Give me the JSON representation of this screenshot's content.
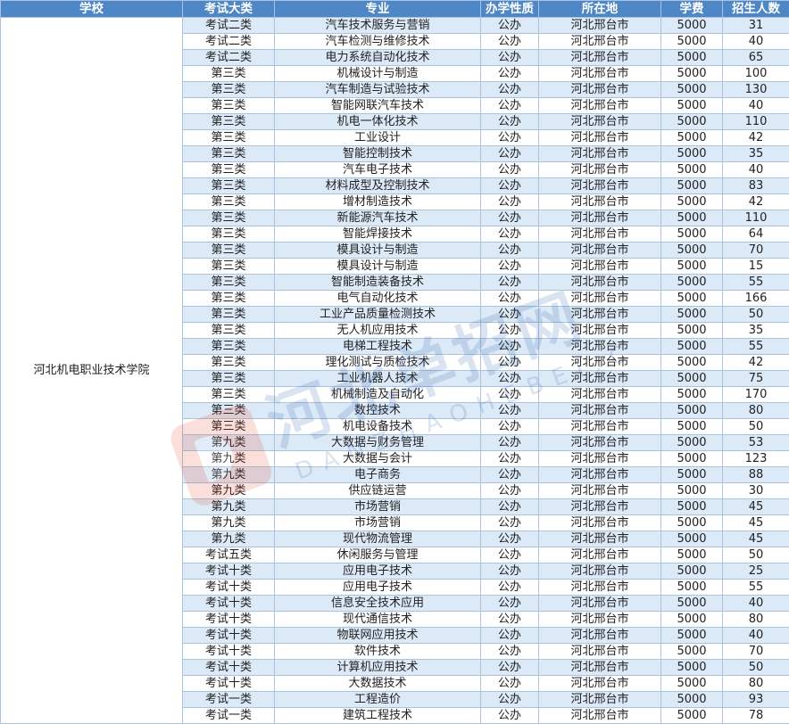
{
  "headers": [
    "学校",
    "考试大类",
    "专业",
    "办学性质",
    "所在地",
    "学费",
    "招生人数"
  ],
  "school": "河北机电职业技术学院",
  "rows": [
    [
      "考试二类",
      "汽车技术服务与营销",
      "公办",
      "河北邢台市",
      "5000",
      "31"
    ],
    [
      "考试二类",
      "汽车检测与维修技术",
      "公办",
      "河北邢台市",
      "5000",
      "40"
    ],
    [
      "考试二类",
      "电力系统自动化技术",
      "公办",
      "河北邢台市",
      "5000",
      "65"
    ],
    [
      "第三类",
      "机械设计与制造",
      "公办",
      "河北邢台市",
      "5000",
      "100"
    ],
    [
      "第三类",
      "汽车制造与试验技术",
      "公办",
      "河北邢台市",
      "5000",
      "130"
    ],
    [
      "第三类",
      "智能网联汽车技术",
      "公办",
      "河北邢台市",
      "5000",
      "40"
    ],
    [
      "第三类",
      "机电一体化技术",
      "公办",
      "河北邢台市",
      "5000",
      "110"
    ],
    [
      "第三类",
      "工业设计",
      "公办",
      "河北邢台市",
      "5000",
      "42"
    ],
    [
      "第三类",
      "智能控制技术",
      "公办",
      "河北邢台市",
      "5000",
      "35"
    ],
    [
      "第三类",
      "汽车电子技术",
      "公办",
      "河北邢台市",
      "5000",
      "40"
    ],
    [
      "第三类",
      "材料成型及控制技术",
      "公办",
      "河北邢台市",
      "5000",
      "83"
    ],
    [
      "第三类",
      "增材制造技术",
      "公办",
      "河北邢台市",
      "5000",
      "42"
    ],
    [
      "第三类",
      "新能源汽车技术",
      "公办",
      "河北邢台市",
      "5000",
      "110"
    ],
    [
      "第三类",
      "智能焊接技术",
      "公办",
      "河北邢台市",
      "5000",
      "64"
    ],
    [
      "第三类",
      "模具设计与制造",
      "公办",
      "河北邢台市",
      "5000",
      "70"
    ],
    [
      "第三类",
      "模具设计与制造",
      "公办",
      "河北邢台市",
      "5000",
      "15"
    ],
    [
      "第三类",
      "智能制造装备技术",
      "公办",
      "河北邢台市",
      "5000",
      "55"
    ],
    [
      "第三类",
      "电气自动化技术",
      "公办",
      "河北邢台市",
      "5000",
      "166"
    ],
    [
      "第三类",
      "工业产品质量检测技术",
      "公办",
      "河北邢台市",
      "5000",
      "50"
    ],
    [
      "第三类",
      "无人机应用技术",
      "公办",
      "河北邢台市",
      "5000",
      "35"
    ],
    [
      "第三类",
      "电梯工程技术",
      "公办",
      "河北邢台市",
      "5000",
      "55"
    ],
    [
      "第三类",
      "理化测试与质检技术",
      "公办",
      "河北邢台市",
      "5000",
      "42"
    ],
    [
      "第三类",
      "工业机器人技术",
      "公办",
      "河北邢台市",
      "5000",
      "75"
    ],
    [
      "第三类",
      "机械制造及自动化",
      "公办",
      "河北邢台市",
      "5000",
      "170"
    ],
    [
      "第三类",
      "数控技术",
      "公办",
      "河北邢台市",
      "5000",
      "80"
    ],
    [
      "第三类",
      "机电设备技术",
      "公办",
      "河北邢台市",
      "5000",
      "50"
    ],
    [
      "第九类",
      "大数据与财务管理",
      "公办",
      "河北邢台市",
      "5000",
      "53"
    ],
    [
      "第九类",
      "大数据与会计",
      "公办",
      "河北邢台市",
      "5000",
      "123"
    ],
    [
      "第九类",
      "电子商务",
      "公办",
      "河北邢台市",
      "5000",
      "88"
    ],
    [
      "第九类",
      "供应链运营",
      "公办",
      "河北邢台市",
      "5000",
      "30"
    ],
    [
      "第九类",
      "市场营销",
      "公办",
      "河北邢台市",
      "5000",
      "45"
    ],
    [
      "第九类",
      "市场营销",
      "公办",
      "河北邢台市",
      "5000",
      "45"
    ],
    [
      "第九类",
      "现代物流管理",
      "公办",
      "河北邢台市",
      "5000",
      "45"
    ],
    [
      "考试五类",
      "休闲服务与管理",
      "公办",
      "河北邢台市",
      "5000",
      "50"
    ],
    [
      "考试十类",
      "应用电子技术",
      "公办",
      "河北邢台市",
      "5000",
      "25"
    ],
    [
      "考试十类",
      "应用电子技术",
      "公办",
      "河北邢台市",
      "5000",
      "55"
    ],
    [
      "考试十类",
      "信息安全技术应用",
      "公办",
      "河北邢台市",
      "5000",
      "40"
    ],
    [
      "考试十类",
      "现代通信技术",
      "公办",
      "河北邢台市",
      "5000",
      "80"
    ],
    [
      "考试十类",
      "物联网应用技术",
      "公办",
      "河北邢台市",
      "5000",
      "40"
    ],
    [
      "考试十类",
      "软件技术",
      "公办",
      "河北邢台市",
      "5000",
      "70"
    ],
    [
      "考试十类",
      "计算机应用技术",
      "公办",
      "河北邢台市",
      "5000",
      "50"
    ],
    [
      "考试十类",
      "大数据技术",
      "公办",
      "河北邢台市",
      "5000",
      "80"
    ],
    [
      "考试一类",
      "工程造价",
      "公办",
      "河北邢台市",
      "5000",
      "93"
    ],
    [
      "考试一类",
      "建筑工程技术",
      "公办",
      "河北邢台市",
      "5000",
      "78"
    ]
  ],
  "watermark": {
    "text": "河北单招网",
    "subtext": "DANZHAOHEBEI.C"
  },
  "colors": {
    "header_bg": "#4e86c6",
    "row_stripe": "#dce9f7",
    "border": "#a9c3e0"
  }
}
